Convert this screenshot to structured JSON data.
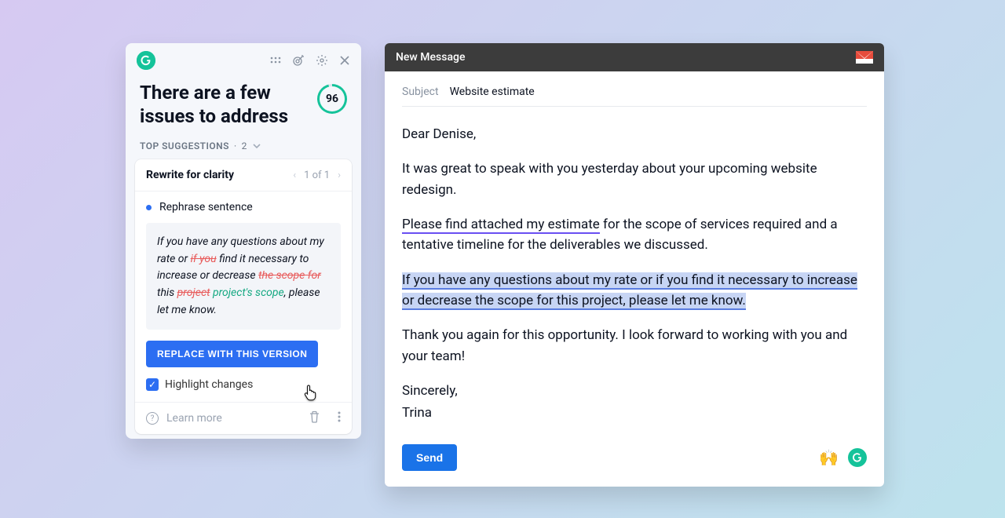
{
  "grammarly": {
    "title": "There are a few issues to address",
    "score": "96",
    "top_suggestions_label": "TOP SUGGESTIONS",
    "top_suggestions_count": "2",
    "card": {
      "title": "Rewrite for clarity",
      "pager": "1 of 1",
      "rephrase_label": "Rephrase sentence",
      "snippet": {
        "p1": "If you have any questions about my rate or ",
        "s1": "if you",
        "p2": " find it necessary to increase or decrease ",
        "s2": "the scope for",
        "p3": " this ",
        "s3": "project",
        "ins": " project's scope",
        "p4": ", please let me know."
      },
      "replace_label": "REPLACE WITH THIS VERSION",
      "highlight_label": "Highlight changes",
      "learn_more": "Learn more"
    }
  },
  "email": {
    "window_title": "New Message",
    "subject_label": "Subject",
    "subject_value": "Website estimate",
    "greeting": "Dear Denise,",
    "para1": "It was great to speak with you yesterday about your upcoming website redesign.",
    "para2_u": "Please find attached my estimate",
    "para2_rest": " for the scope of services required and a tentative timeline for the deliverables we discussed.",
    "para3": "If you have any questions about my rate or if you find it necessary to increase or decrease the scope for this project, please let me know.",
    "para4": "Thank you again for this opportunity. I look forward to working with you and your team!",
    "signoff1": "Sincerely,",
    "signoff2": "Trina",
    "send_label": "Send"
  }
}
